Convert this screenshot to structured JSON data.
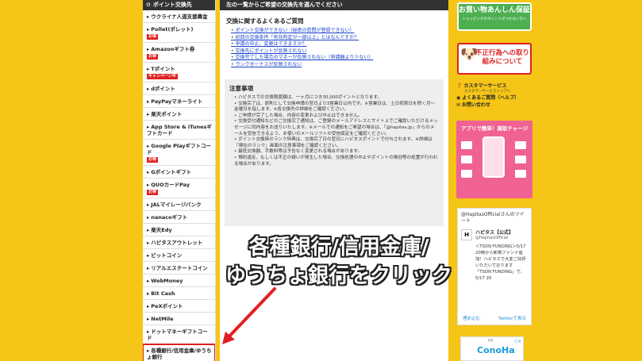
{
  "sidebar": {
    "title": "ポイント交換先",
    "items": [
      {
        "label": "ウクライナ人道支援募金",
        "badge": ""
      },
      {
        "label": "Pollet(ポレット)",
        "badge": "お得"
      },
      {
        "label": "Amazonギフト券",
        "badge": "お得"
      },
      {
        "label": "Tポイント",
        "badge": "キャンペーン中"
      },
      {
        "label": "dポイント",
        "badge": ""
      },
      {
        "label": "PayPayマネーライト",
        "badge": ""
      },
      {
        "label": "楽天ポイント",
        "badge": ""
      },
      {
        "label": "App Store & iTunesギフトカード",
        "badge": ""
      },
      {
        "label": "Google Playギフトコード",
        "badge": "お得"
      },
      {
        "label": "Gポイントギフト",
        "badge": ""
      },
      {
        "label": "QUOカードPay",
        "badge": "お得"
      },
      {
        "label": "JALマイレージバンク",
        "badge": ""
      },
      {
        "label": "nanacoギフト",
        "badge": ""
      },
      {
        "label": "楽天Edy",
        "badge": ""
      },
      {
        "label": "ハピタスアウトレット",
        "badge": ""
      },
      {
        "label": "ビットコイン",
        "badge": ""
      },
      {
        "label": "リアルエステートコイン",
        "badge": ""
      },
      {
        "label": "WebMoney",
        "badge": ""
      },
      {
        "label": "Bit Cash",
        "badge": ""
      },
      {
        "label": "PeXポイント",
        "badge": ""
      },
      {
        "label": "NetMile",
        "badge": ""
      },
      {
        "label": "ドットマネーギフトコード",
        "badge": ""
      },
      {
        "label": "各種銀行/信用金庫/ゆうちょ銀行",
        "badge": ""
      }
    ]
  },
  "main": {
    "header": "左の一覧からご希望の交換先を選んでください",
    "faq_title": "交換に関するよくあるご質問",
    "faq": [
      "ポイント交換ができない（秘密の質問が登録できない）",
      "初回の交換条件「有効判定が一部以上」とはなんですか？",
      "申請の中止、変更はできますか？",
      "交換先にポイントが反映されない",
      "交換完了した場合のマネーが反映されない（申請額より少ない）",
      "ランクボーナスが反映されない"
    ],
    "notes_title": "注意事項",
    "notes": [
      "ハピタスでの交換限度額は、一ヶ月につき30,000ポイントとなります。",
      "交換完了は、原則として交換申請の翌日より3営業日以内です。※営業日は、土日祝祭日を除く月〜金曜日を指します。※各交換先の詳細をご確認ください。",
      "ご申請が完了した場合、内容の変更および中止はできません。",
      "交換受付通知などのご交換完了通知は、ご登録のメールアドレスとサイト上でご確認いただけるメッセージに同内容をお送りいたします。※メールでの通知をご希望の場合は、「@hapitas.jp」からのメールを受信できるよう、お使いのメールソフトの受信設定をご確認ください。",
      "ポイント交換時のランク特典は、交換完了日の翌日にハピタスポイントで付与されます。※詳細は「現在のランク」画面の注意事項をご確認ください。",
      "最低交換額、手数料等は予告なく変更される場合があります。",
      "規約違反、もしくは不正の疑いが発生した場合、交換処理の中止やポイントの無効等の処置が行われる場合があります。"
    ]
  },
  "overlay": {
    "line1": "各種銀行/信用金庫/",
    "line2": "ゆうちょ銀行をクリック"
  },
  "right": {
    "promo1_main": "お買い物あんしん保証",
    "promo1_sub": "ショッピングのポイントがつかない方へ",
    "promo2_main": "不正行為への取り組みについて",
    "support_label": "カスタマーサービス",
    "support_sub": "カスタマーサービストップへ",
    "faq_link": "よくあるご質問（ヘルプ）",
    "contact_link": "お問い合わせ",
    "app_title": "アプリで簡単！買取チャージ",
    "twitter_head": "@HapitasOfficialさんのツイート",
    "tweet_name": "ハピタス【公式】",
    "tweet_handle": "@HapitasOfficial",
    "tweet_body": "＜TSON FUNDING＞5/17 20時から新規ファンド追加！ハピタスで大変ご好評いただいております「TSON FUNDING」で、5/17 20",
    "tw_embed": "埋め込む",
    "tw_view": "Twitterで表示",
    "ad_pr": "PR",
    "ad_logo": "ConoHa"
  },
  "colors": {
    "background": "#f5c518",
    "header_dark": "#333333",
    "link_blue": "#1a44cc",
    "badge_red": "#e02020",
    "highlight_red": "#e02020"
  }
}
